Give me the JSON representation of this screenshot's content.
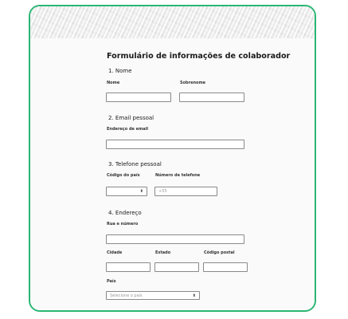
{
  "form": {
    "title": "Formulário de informações de colaborador",
    "sections": {
      "name": {
        "heading": "1. Nome",
        "first_label": "Nome",
        "last_label": "Sobrenome"
      },
      "email": {
        "heading": "2. Email pessoal",
        "email_label": "Endereço de email"
      },
      "phone": {
        "heading": "3. Telefone pessoal",
        "country_code_label": "Código do país",
        "number_label": "Número de telefone",
        "number_placeholder": "+55"
      },
      "address": {
        "heading": "4. Endereço",
        "street_label": "Rua e número",
        "city_label": "Cidade",
        "state_label": "Estado",
        "zip_label": "Código postal",
        "country_label": "País",
        "country_placeholder": "Selecione o país"
      }
    }
  },
  "colors": {
    "frame_border": "#2bb673",
    "input_border": "#8a8a8a"
  }
}
